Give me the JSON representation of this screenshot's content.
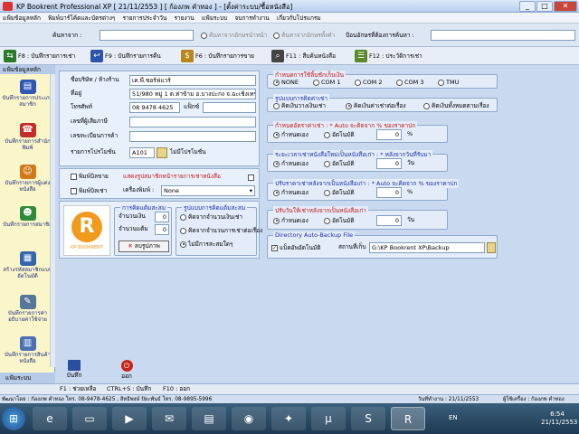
{
  "window": {
    "title": "KP Bookrent Professional XP [ 21/11/2553 ] [ ก้องภพ คำทอง ] - [ตั้งค่าระบบ/ซื้อหนังสือ]",
    "min": "_",
    "max": "□",
    "close": "✕"
  },
  "menu": [
    "แฟ้มข้อมูลหลัก",
    "พิมพ์บาร์โค้ดและบัตรต่างๆ",
    "รายการประจำวัน",
    "รายงาน",
    "แฟ้มระบบ",
    "จบการทำงาน",
    "เกี่ยวกับโปรแกรม"
  ],
  "search": {
    "label": "ค้นหาจาก :",
    "opt1": "ค้นหาจากอักษรนำหน้า",
    "opt2": "ค้นหาจากอักษรทั้งคำ",
    "right_label": "ป้อนอักษรที่ต้องการค้นหา :"
  },
  "toolbar": [
    {
      "key": "F8",
      "label": "F8 : บันทึกรายการเช่า",
      "icon": "rent-icon",
      "color": "#2a7a2a"
    },
    {
      "key": "F9",
      "label": "F9 : บันทึกรายการคืน",
      "icon": "return-icon",
      "color": "#2a55a8"
    },
    {
      "key": "F6",
      "label": "F6 : บันทึกรายการขาย",
      "icon": "sale-icon",
      "color": "#b8861a"
    },
    {
      "key": "F11",
      "label": "F11 : สืบค้นหนังสือ",
      "icon": "search-book-icon",
      "color": "#444"
    },
    {
      "key": "F12",
      "label": "F12 : ประวัติการเช่า",
      "icon": "history-icon",
      "color": "#5a8a2a"
    }
  ],
  "sidebar": {
    "header": "แฟ้มข้อมูลหลัก",
    "footer": "แฟ้มระบบ",
    "items": [
      {
        "label": "บันทึกรายการประเภทสมาชิก",
        "icon": "book-icon",
        "color": "#2d57b3",
        "glyph": "▤"
      },
      {
        "label": "บันทึกรายการสำนักพิมพ์",
        "icon": "phone-icon",
        "color": "#c32d2d",
        "glyph": "☎"
      },
      {
        "label": "บันทึกรายการผู้แต่งหนังสือ",
        "icon": "people-icon",
        "color": "#d07a1a",
        "glyph": "☺"
      },
      {
        "label": "บันทึกรายการสมาชิก",
        "icon": "member-icon",
        "color": "#2e8b3c",
        "glyph": "☻"
      },
      {
        "label": "สร้างรหัสสมาชิกแบบอัตโนมัติ",
        "icon": "form-icon",
        "color": "#3366aa",
        "glyph": "▦"
      },
      {
        "label": "บันทึกรายการค่าอธิบายค่าใช้จ่าย",
        "icon": "document-icon",
        "color": "#557799",
        "glyph": "✎"
      },
      {
        "label": "บันทึกรายการสินค้าหนังสือ",
        "icon": "books-icon",
        "color": "#4a6fb5",
        "glyph": "▥"
      }
    ]
  },
  "shop": {
    "name_label": "ชื่อบริษัท / ห้างร้าน",
    "name_value": "เค.พี.ซอร์ฟแวร์",
    "addr_label": "ที่อยู่",
    "addr_value": "51/980 หมู่ 1 ต.ท่าข้าม อ.บางปะกง จ.ฉะเชิงเทรา",
    "phone_label": "โทรศัพท์",
    "phone_value": "08 9478 4625",
    "fax_label": "แฟ็กซ์",
    "tax_label": "เลขที่ผู้เสียภาษี",
    "reg_label": "เลขทะเบียนการค้า",
    "promo_label": "รายการโปรโมชั่น",
    "promo_value": "A101",
    "promo_btn": "ไม่มีโปรโมชั่น"
  },
  "print": {
    "opt_receipt": "พิมพ์บิลขาย",
    "opt_rent": "พิมพ์บิลเช่า",
    "show_label": "แสดงรูปสมาชิกหน้ารายการเช่าหนังสือ",
    "printer_label": "เครื่องพิมพ์ :",
    "printer_value": "None"
  },
  "points": {
    "title": "การคิดแต้มสะสม",
    "amount_label": "จำนวนเงิน",
    "amount_value": "0",
    "points_label": "จำนวนแต้ม",
    "points_value": "0",
    "clear_btn": "ลบรูปภาพ"
  },
  "points_mode": {
    "title": "รูปแบบการคิดแต้มสะสม",
    "o1": "คิดจากจำนวนเงินเช่า",
    "o2": "คิดจากจำนวนการเช่าต่อเรื่อง",
    "o3": "ไม่มีการสะสมใดๆ"
  },
  "port": {
    "title": "กำหนดการใช้ลิ้นชักเก็บเงิน",
    "opts": [
      "NONE",
      "COM 1",
      "COM 2",
      "COM 3",
      "TMU"
    ]
  },
  "fee_mode": {
    "title": "รูปแบบการคิดค่าเช่า",
    "o1": "คิดเงินวางเงินเช่า",
    "o2": "คิดเงินค่าเช่าต่อเรื่อง",
    "o3": "คิดเงินทั้งหมดตามเรื่อง"
  },
  "rent_price": {
    "title": "กำหนดอัตราค่าเช่า : * Auto จะคิดจาก % ของราคาปก",
    "o1": "กำหนดเอง",
    "o2": "อัตโนมัติ",
    "value": "0",
    "unit": "%"
  },
  "overdue": {
    "title": "ระยะเวลาเช่าหนังสือใหม่เป็นหนังสือเก่า : * หลังจากวันที่รับมา",
    "o1": "กำหนดเอง",
    "o2": "อัตโนมัติ",
    "value": "0",
    "unit": "วัน"
  },
  "deposit": {
    "title": "ปรับราคาเช่าหลังจากเป็นหนังสือเก่า : * Auto จะคิดจาก % ของราคาปก",
    "o1": "กำหนดเอง",
    "o2": "อัตโนมัติ",
    "value": "0",
    "unit": "%"
  },
  "days": {
    "title": "ปรับวันให้เช่าหลังจากเป็นหนังสือเก่า",
    "o1": "กำหนดเอง",
    "o2": "อัตโนมัติ",
    "value": "0",
    "unit": "วัน"
  },
  "backup": {
    "title": "Directory Auto-Backup File",
    "chk": "แบ็คอัพอัตโนมัติ",
    "path_label": "สถานที่เก็บ",
    "path_value": "G:\\KP Bookrent XP\\Backup"
  },
  "actions": {
    "save": "บันทึก",
    "exit": "ออก"
  },
  "logo": {
    "letter": "R",
    "text": "KP BOOKRENT"
  },
  "status": {
    "f1": "F1 : ช่วยเหลือ",
    "save": "CTRL+S : บันทึก",
    "f10": "F10 : ออก"
  },
  "status2": {
    "left": "พัฒนาโดย : ก้องภพ คำทอง โทร. 08-9478-4625 , สิทธิพงษ์ ปัยะพันธ์ โทร. 08-9895-5996",
    "date": "วันที่ทำงาน : 21/11/2553",
    "user": "ผู้ใช้เครื่อง : ก้องภพ คำทอง"
  },
  "taskbar": {
    "lang": "EN",
    "time": "6:54",
    "date": "21/11/2553"
  }
}
